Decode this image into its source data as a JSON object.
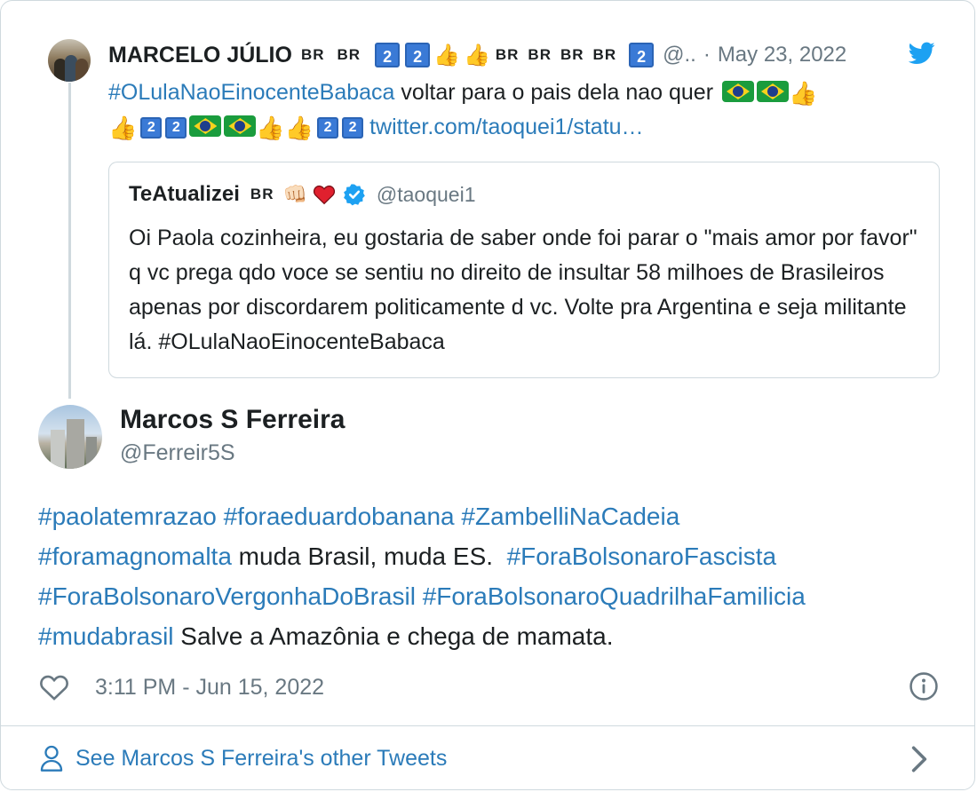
{
  "parent_tweet": {
    "name": "MARCELO JÚLIO",
    "name_emoji_tags": [
      "BR",
      "BR"
    ],
    "handle_truncated": "@..",
    "separator": "·",
    "date": "May 23, 2022",
    "text_parts": [
      {
        "kind": "hashtag",
        "text": "#OLulaNaoEinocenteBabaca"
      },
      {
        "kind": "text",
        "text": " voltar para o pais dela nao quer "
      }
    ],
    "link": "twitter.com/taoquei1/statu…",
    "keycap_digit": "2",
    "flag_tag": "BR"
  },
  "quoted_tweet": {
    "name": "TeAtualizei",
    "flag_tag": "BR",
    "handle": "@taoquei1",
    "text_before": "Oi Paola cozinheira, eu gostaria de saber onde foi parar o \"mais amor por favor\" q vc prega qdo voce se sentiu no direito de insultar 58 milhoes de Brasileiros apenas por discordarem politicamente d vc. Volte pra Argentina e seja militante lá. ",
    "hashtag": "#OLulaNaoEinocenteBabaca"
  },
  "main_tweet": {
    "name": "Marcos S Ferreira",
    "handle": "@Ferreir5S",
    "parts": [
      {
        "kind": "hashtag",
        "text": "#paolatemrazao"
      },
      {
        "kind": "text",
        "text": " "
      },
      {
        "kind": "hashtag",
        "text": "#foraeduardobanana"
      },
      {
        "kind": "text",
        "text": " "
      },
      {
        "kind": "hashtag",
        "text": "#ZambelliNaCadeia"
      },
      {
        "kind": "text",
        "text": " "
      },
      {
        "kind": "hashtag",
        "text": "#foramagnomalta"
      },
      {
        "kind": "text",
        "text": " muda Brasil, muda ES.  "
      },
      {
        "kind": "hashtag",
        "text": "#ForaBolsonaroFascista"
      },
      {
        "kind": "text",
        "text": " "
      },
      {
        "kind": "hashtag",
        "text": "#ForaBolsonaroVergonhaDoBrasil"
      },
      {
        "kind": "text",
        "text": " "
      },
      {
        "kind": "hashtag",
        "text": "#ForaBolsonaroQuadrilhaFamilicia"
      },
      {
        "kind": "text",
        "text": " "
      },
      {
        "kind": "hashtag",
        "text": "#mudabrasil"
      },
      {
        "kind": "text",
        "text": " Salve a Amazônia e chega de mamata."
      }
    ],
    "timestamp": "3:11 PM - Jun 15, 2022"
  },
  "footer": {
    "label": "See Marcos S Ferreira's other Tweets"
  },
  "icons": {
    "bird": "twitter-bird-icon",
    "verified": "verified-badge-icon",
    "like": "heart-outline-icon",
    "info": "info-icon",
    "person": "person-icon",
    "chevron": "chevron-right-icon"
  },
  "colors": {
    "link": "#2b7bb9",
    "muted": "#697882",
    "border": "#cfd9de",
    "twitter_blue": "#1da1f2"
  }
}
